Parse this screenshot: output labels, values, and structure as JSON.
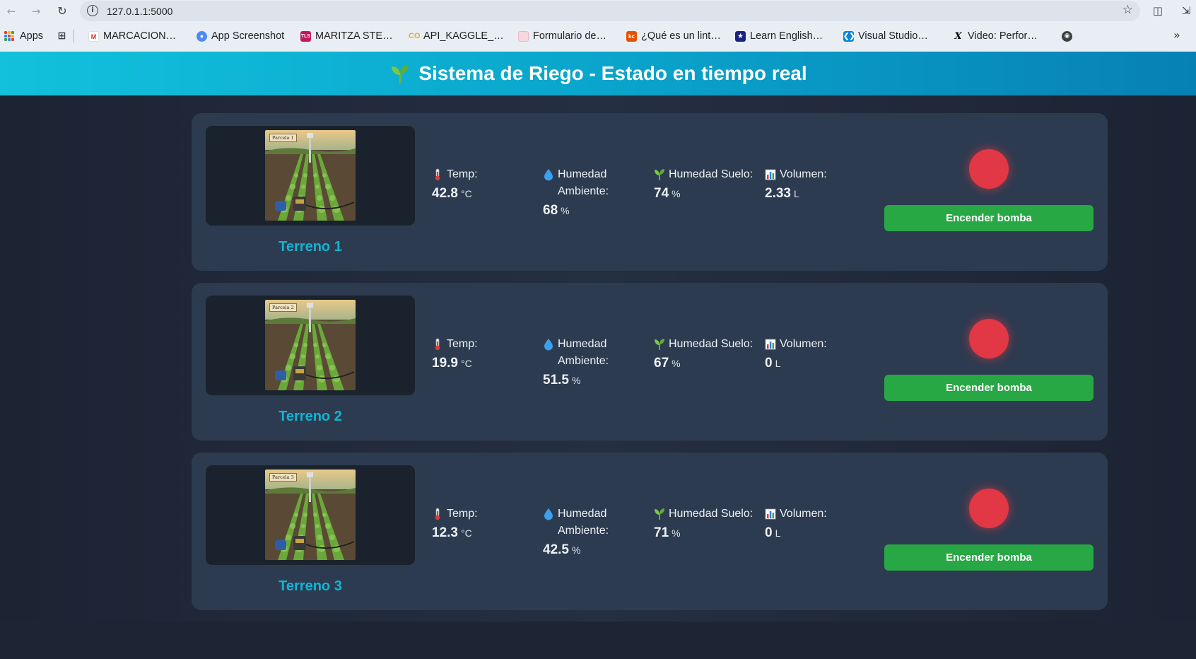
{
  "browser": {
    "url": "127.0.1.1:5000",
    "bookmarks": [
      {
        "label": "Apps",
        "icon": "apps-grid-icon"
      },
      {
        "label": "",
        "icon": "tab-groups-icon"
      },
      {
        "label": "MARCACION…",
        "icon": "gmail-icon"
      },
      {
        "label": "App Screenshot",
        "icon": "google-bookmark-icon"
      },
      {
        "label": "MARITZA STE…",
        "icon": "tls-icon"
      },
      {
        "label": "API_KAGGLE_…",
        "icon": "colab-icon"
      },
      {
        "label": "Formulario de…",
        "icon": "form-icon"
      },
      {
        "label": "¿Qué es un lint…",
        "icon": "kc-icon"
      },
      {
        "label": "Learn English…",
        "icon": "star-logo-icon"
      },
      {
        "label": "Visual Studio…",
        "icon": "vscode-icon"
      },
      {
        "label": "Video: Perfor…",
        "icon": "x-icon"
      },
      {
        "label": "",
        "icon": "globe-icon"
      }
    ]
  },
  "header": {
    "title": "Sistema de Riego - Estado en tiempo real"
  },
  "metric_labels": {
    "temp": "Temp:",
    "hum": "Humedad Ambiente:",
    "soil": "Humedad Suelo:",
    "vol": "Volumen:"
  },
  "units": {
    "temp": "°C",
    "hum": "%",
    "soil": "%",
    "vol": "L"
  },
  "terrenos": [
    {
      "name": "Terreno 1",
      "parcela": "Parcela 1",
      "temp": "42.8",
      "hum": "68",
      "soil": "74",
      "vol": "2.33",
      "button": "Encender bomba",
      "status_color": "#e23744"
    },
    {
      "name": "Terreno 2",
      "parcela": "Parcela 2",
      "temp": "19.9",
      "hum": "51.5",
      "soil": "67",
      "vol": "0",
      "button": "Encender bomba",
      "status_color": "#e23744"
    },
    {
      "name": "Terreno 3",
      "parcela": "Parcela 3",
      "temp": "12.3",
      "hum": "42.5",
      "soil": "71",
      "vol": "0",
      "button": "Encender bomba",
      "status_color": "#e23744"
    }
  ]
}
